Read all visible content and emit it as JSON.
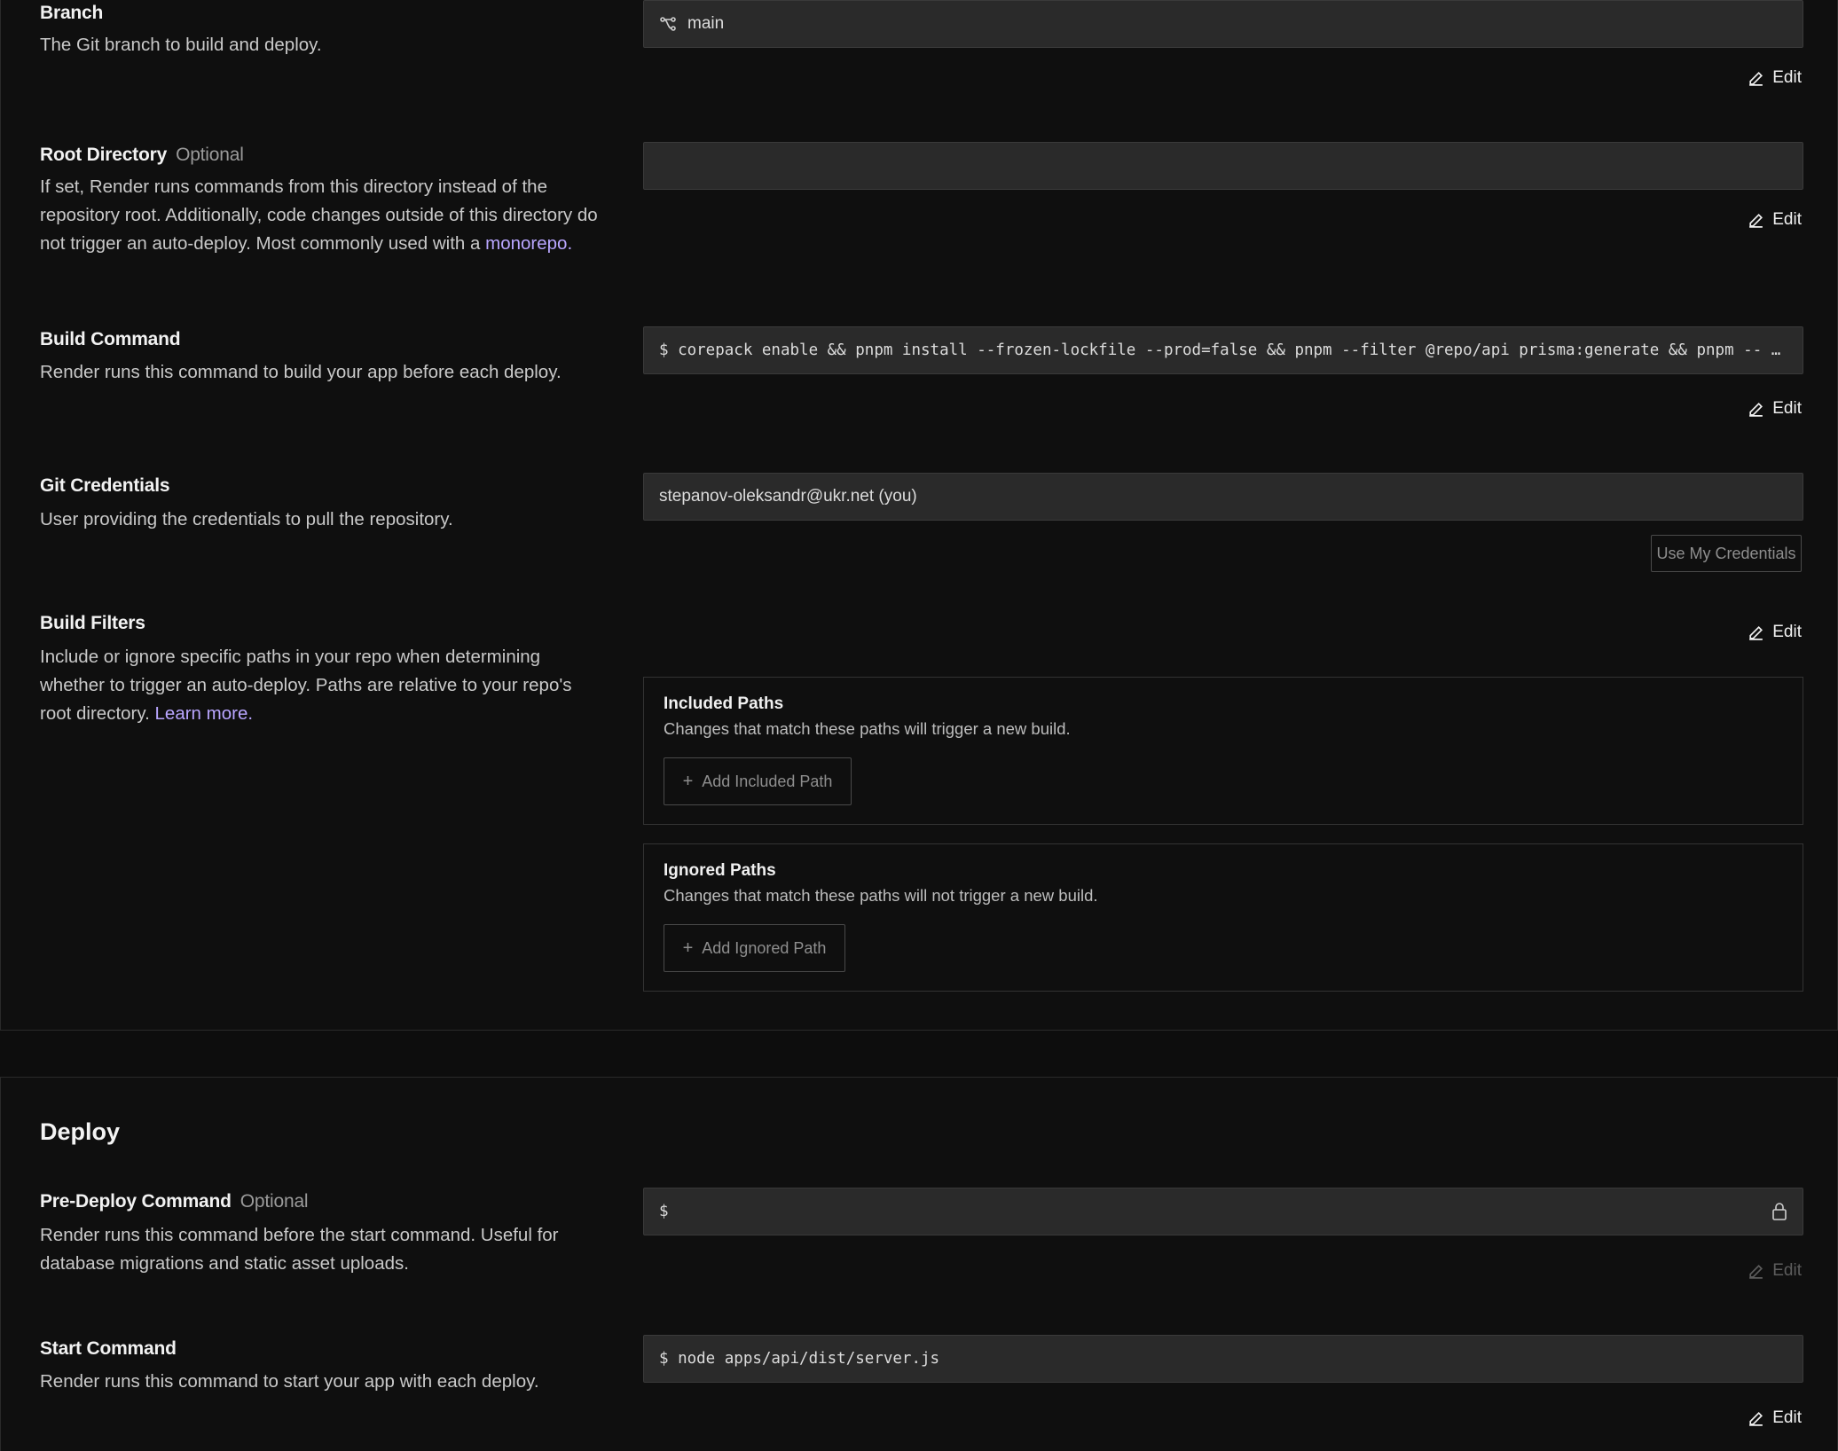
{
  "build": {
    "branch": {
      "label": "Branch",
      "description": "The Git branch to build and deploy.",
      "value": "main",
      "edit": "Edit"
    },
    "root_directory": {
      "label": "Root Directory",
      "optional": "Optional",
      "description": "If set, Render runs commands from this directory instead of the repository root. Additionally, code changes outside of this directory do not trigger an auto-deploy. Most commonly used with a",
      "link": "monorepo",
      "value": "",
      "edit": "Edit"
    },
    "build_command": {
      "label": "Build Command",
      "description": "Render runs this command to build your app before each deploy.",
      "value": "$ corepack enable && pnpm install --frozen-lockfile --prod=false && pnpm --filter @repo/api prisma:generate && pnpm -- …",
      "edit": "Edit"
    },
    "git_credentials": {
      "label": "Git Credentials",
      "description": "User providing the credentials to pull the repository.",
      "value": "stepanov-oleksandr@ukr.net (you)",
      "button": "Use My Credentials"
    },
    "build_filters": {
      "label": "Build Filters",
      "description": "Include or ignore specific paths in your repo when determining whether to trigger an auto-deploy. Paths are relative to your repo's root directory.",
      "link": "Learn more.",
      "edit": "Edit",
      "included": {
        "title": "Included Paths",
        "description": "Changes that match these paths will trigger a new build.",
        "button": "Add Included Path"
      },
      "ignored": {
        "title": "Ignored Paths",
        "description": "Changes that match these paths will not trigger a new build.",
        "button": "Add Ignored Path"
      }
    }
  },
  "deploy": {
    "title": "Deploy",
    "pre_deploy": {
      "label": "Pre-Deploy Command",
      "optional": "Optional",
      "description": "Render runs this command before the start command. Useful for database migrations and static asset uploads.",
      "value": "$",
      "edit": "Edit"
    },
    "start_command": {
      "label": "Start Command",
      "description": "Render runs this command to start your app with each deploy.",
      "value": "$ node apps/api/dist/server.js",
      "edit": "Edit"
    }
  },
  "colors": {
    "background": "#0f0f0f",
    "field": "#2a2a2a",
    "link": "#b9a6ff"
  },
  "icons": [
    "branch-icon",
    "pencil-icon",
    "lock-icon",
    "plus-icon"
  ]
}
